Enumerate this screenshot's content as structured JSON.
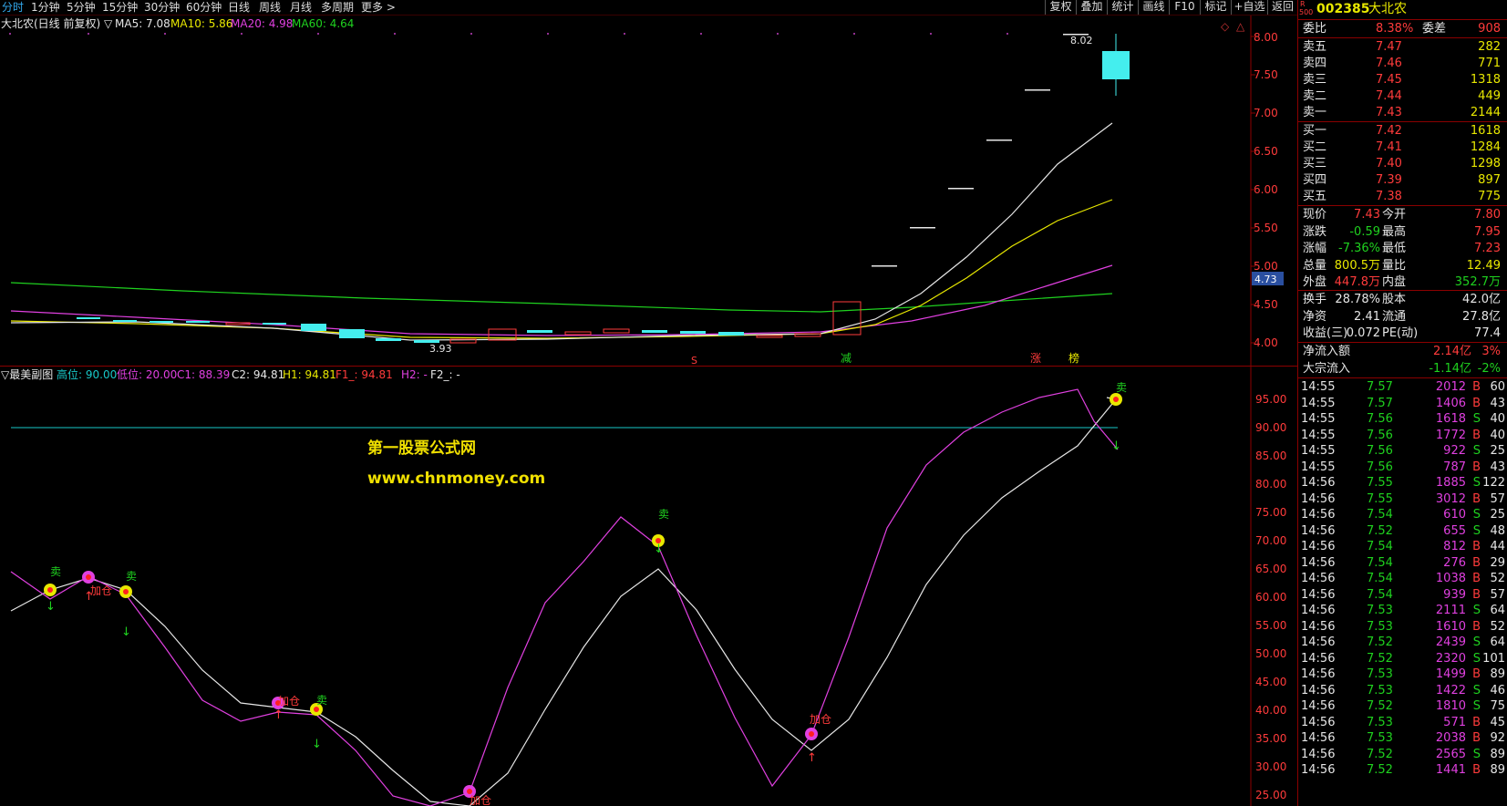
{
  "tabs": [
    "分时",
    "1分钟",
    "5分钟",
    "15分钟",
    "30分钟",
    "60分钟",
    "日线",
    "周线",
    "月线",
    "多周期",
    "更多 >"
  ],
  "toolbar": [
    "复权",
    "叠加",
    "统计",
    "画线",
    "F10",
    "标记",
    "+自选",
    "返回"
  ],
  "main_legend": {
    "title": "大北农(日线 前复权) ▽",
    "ma5": "MA5: 7.08",
    "ma10": "MA10: 5.86",
    "ma20": "MA20: 4.98",
    "ma60": "MA60: 4.64"
  },
  "main_axis": [
    "8.00",
    "7.50",
    "7.00",
    "6.50",
    "6.00",
    "5.50",
    "5.00",
    "4.50",
    "4.00"
  ],
  "main_annotations": {
    "high": "8.02",
    "low": "3.93",
    "price_tag": "4.73",
    "mark_s": "S",
    "mark_jian": "减",
    "mark_zhang": "涨",
    "mark_bang": "榜"
  },
  "sub_legend": {
    "title": "▽最美副图",
    "high_level": "高位: 90.00",
    "low_level": "低位: 20.00",
    "c1": "C1: 88.39",
    "c2": "C2: 94.81",
    "h1": "H1: 94.81",
    "f1": "F1_: 94.81",
    "h2": "H2: -",
    "f2": "F2_: -"
  },
  "sub_axis": [
    "95.00",
    "90.00",
    "85.00",
    "80.00",
    "75.00",
    "70.00",
    "65.00",
    "60.00",
    "55.00",
    "50.00",
    "45.00",
    "40.00",
    "35.00",
    "30.00",
    "25.00"
  ],
  "watermark": {
    "line1": "第一股票公式网",
    "line2": "www.chnmoney.com"
  },
  "signals": {
    "sell": "卖",
    "add": "加仓"
  },
  "stock": {
    "logo_top": "R",
    "logo_bottom": "500",
    "code": "002385",
    "name": "大北农"
  },
  "weibi": {
    "label": "委比",
    "value": "8.38%",
    "label2": "委差",
    "value2": "908"
  },
  "sells": [
    {
      "label": "卖五",
      "price": "7.47",
      "vol": "282"
    },
    {
      "label": "卖四",
      "price": "7.46",
      "vol": "771"
    },
    {
      "label": "卖三",
      "price": "7.45",
      "vol": "1318"
    },
    {
      "label": "卖二",
      "price": "7.44",
      "vol": "449"
    },
    {
      "label": "卖一",
      "price": "7.43",
      "vol": "2144"
    }
  ],
  "buys": [
    {
      "label": "买一",
      "price": "7.42",
      "vol": "1618"
    },
    {
      "label": "买二",
      "price": "7.41",
      "vol": "1284"
    },
    {
      "label": "买三",
      "price": "7.40",
      "vol": "1298"
    },
    {
      "label": "买四",
      "price": "7.39",
      "vol": "897"
    },
    {
      "label": "买五",
      "price": "7.38",
      "vol": "775"
    }
  ],
  "quote": [
    {
      "l1": "现价",
      "v1": "7.43",
      "l2": "今开",
      "v2": "7.80"
    },
    {
      "l1": "涨跌",
      "v1": "-0.59",
      "l2": "最高",
      "v2": "7.95"
    },
    {
      "l1": "涨幅",
      "v1": "-7.36%",
      "l2": "最低",
      "v2": "7.23"
    },
    {
      "l1": "总量",
      "v1": "800.5万",
      "l2": "量比",
      "v2": "12.49"
    },
    {
      "l1": "外盘",
      "v1": "447.8万",
      "l2": "内盘",
      "v2": "352.7万"
    }
  ],
  "fund": [
    {
      "l1": "换手",
      "v1": "28.78%",
      "l2": "股本",
      "v2": "42.0亿"
    },
    {
      "l1": "净资",
      "v1": "2.41",
      "l2": "流通",
      "v2": "27.8亿"
    },
    {
      "l1": "收益(三)",
      "v1": "0.072",
      "l2": "PE(动)",
      "v2": "77.4"
    }
  ],
  "flows": [
    {
      "label": "净流入额",
      "value": "2.14亿",
      "pct": "3%"
    },
    {
      "label": "大宗流入",
      "value": "-1.14亿",
      "pct": "-2%"
    }
  ],
  "ticks": [
    {
      "t": "14:55",
      "p": "7.57",
      "v": "2012",
      "bs": "B",
      "n": "60"
    },
    {
      "t": "14:55",
      "p": "7.57",
      "v": "1406",
      "bs": "B",
      "n": "43"
    },
    {
      "t": "14:55",
      "p": "7.56",
      "v": "1618",
      "bs": "S",
      "n": "40"
    },
    {
      "t": "14:55",
      "p": "7.56",
      "v": "1772",
      "bs": "B",
      "n": "40"
    },
    {
      "t": "14:55",
      "p": "7.56",
      "v": "922",
      "bs": "S",
      "n": "25"
    },
    {
      "t": "14:55",
      "p": "7.56",
      "v": "787",
      "bs": "B",
      "n": "43"
    },
    {
      "t": "14:56",
      "p": "7.55",
      "v": "1885",
      "bs": "S",
      "n": "122"
    },
    {
      "t": "14:56",
      "p": "7.55",
      "v": "3012",
      "bs": "B",
      "n": "57"
    },
    {
      "t": "14:56",
      "p": "7.54",
      "v": "610",
      "bs": "S",
      "n": "25"
    },
    {
      "t": "14:56",
      "p": "7.52",
      "v": "655",
      "bs": "S",
      "n": "48"
    },
    {
      "t": "14:56",
      "p": "7.54",
      "v": "812",
      "bs": "B",
      "n": "44"
    },
    {
      "t": "14:56",
      "p": "7.54",
      "v": "276",
      "bs": "B",
      "n": "29"
    },
    {
      "t": "14:56",
      "p": "7.54",
      "v": "1038",
      "bs": "B",
      "n": "52"
    },
    {
      "t": "14:56",
      "p": "7.54",
      "v": "939",
      "bs": "B",
      "n": "57"
    },
    {
      "t": "14:56",
      "p": "7.53",
      "v": "2111",
      "bs": "S",
      "n": "64"
    },
    {
      "t": "14:56",
      "p": "7.53",
      "v": "1610",
      "bs": "B",
      "n": "52"
    },
    {
      "t": "14:56",
      "p": "7.52",
      "v": "2439",
      "bs": "S",
      "n": "64"
    },
    {
      "t": "14:56",
      "p": "7.52",
      "v": "2320",
      "bs": "S",
      "n": "101"
    },
    {
      "t": "14:56",
      "p": "7.53",
      "v": "1499",
      "bs": "B",
      "n": "89"
    },
    {
      "t": "14:56",
      "p": "7.53",
      "v": "1422",
      "bs": "S",
      "n": "46"
    },
    {
      "t": "14:56",
      "p": "7.52",
      "v": "1810",
      "bs": "S",
      "n": "75"
    },
    {
      "t": "14:56",
      "p": "7.53",
      "v": "571",
      "bs": "B",
      "n": "45"
    },
    {
      "t": "14:56",
      "p": "7.53",
      "v": "2038",
      "bs": "B",
      "n": "92"
    },
    {
      "t": "14:56",
      "p": "7.52",
      "v": "2565",
      "bs": "S",
      "n": "89"
    },
    {
      "t": "14:56",
      "p": "7.52",
      "v": "1441",
      "bs": "B",
      "n": "89"
    }
  ],
  "colors": {
    "up": "#ff3b3b",
    "down": "#1fd21f",
    "ma5": "#e6e6e6",
    "ma10": "#e8e800",
    "ma20": "#e040e0",
    "ma60": "#1fd21f",
    "axis": "#8b0000"
  }
}
